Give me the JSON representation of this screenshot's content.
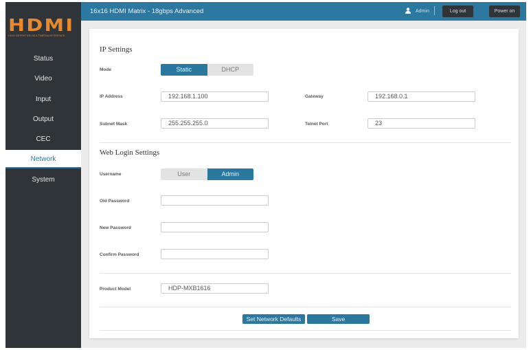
{
  "logo": {
    "text": "HDMI",
    "tagline": "HIGH-DEFINITION MULTIMEDIA INTERFACE"
  },
  "sidebar": {
    "items": [
      {
        "label": "Status"
      },
      {
        "label": "Video"
      },
      {
        "label": "Input"
      },
      {
        "label": "Output"
      },
      {
        "label": "CEC"
      },
      {
        "label": "Network",
        "active": true
      },
      {
        "label": "System"
      }
    ]
  },
  "header": {
    "title": "16x16 HDMI Matrix - 18gbps Advanced",
    "user": "Admin",
    "logout": "Log out",
    "power": "Power on"
  },
  "ip_settings": {
    "title": "IP Settings",
    "mode_label": "Mode",
    "mode_options": [
      "Static",
      "DHCP"
    ],
    "mode_selected": "Static",
    "ip_label": "IP Address",
    "ip": "192.168.1.100",
    "gateway_label": "Gateway",
    "gateway": "192.168.0.1",
    "subnet_label": "Subnet Mask",
    "subnet": "255.255.255.0",
    "telnet_label": "Telnet Port",
    "telnet": "23"
  },
  "web_login": {
    "title": "Web Login Settings",
    "username_label": "Username",
    "username_options": [
      "User",
      "Admin"
    ],
    "username_selected": "Admin",
    "old_label": "Old Password",
    "old": "",
    "new_label": "New Password",
    "new": "",
    "confirm_label": "Confirm Password",
    "confirm": ""
  },
  "product": {
    "label": "Product Model",
    "value": "HDP-MXB1616"
  },
  "actions": {
    "defaults": "Set Network Defaults",
    "save": "Save"
  }
}
